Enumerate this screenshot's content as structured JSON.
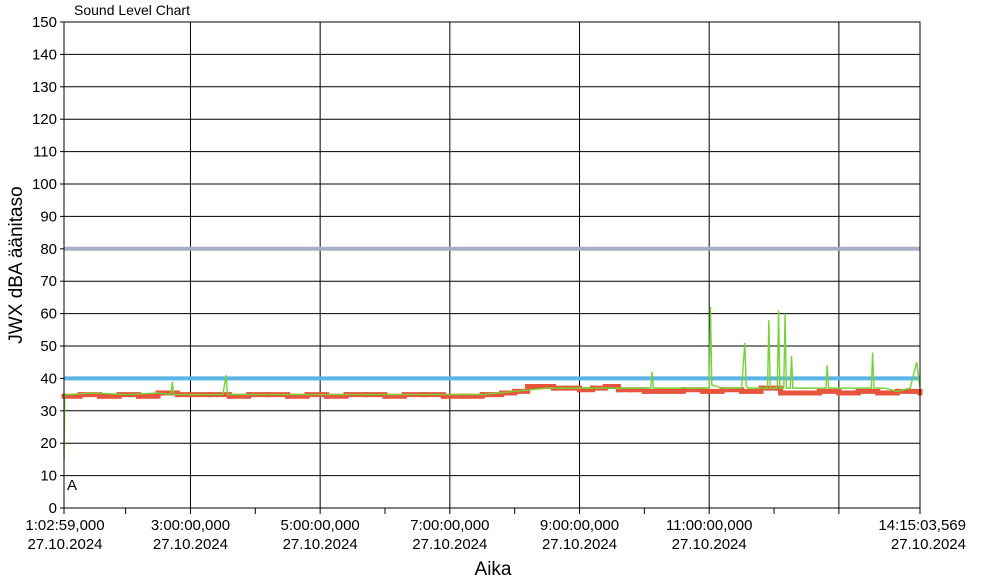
{
  "chart_data": {
    "type": "line",
    "title": "Sound Level Chart",
    "xlabel": "Aika",
    "ylabel": "JWX dBA äänitaso",
    "ylim": [
      0,
      150
    ],
    "y_ticks": [
      0,
      10,
      20,
      30,
      40,
      50,
      60,
      70,
      80,
      90,
      100,
      110,
      120,
      130,
      140,
      150
    ],
    "x_range": [
      "27.10.2024 1:02:59,000",
      "27.10.2024 14:15:03,569"
    ],
    "x_tick_labels": [
      {
        "time": "1:02:59,000",
        "date": "27.10.2024",
        "hour": 1.0497
      },
      {
        "time": "3:00:00,000",
        "date": "27.10.2024",
        "hour": 3.0
      },
      {
        "time": "5:00:00,000",
        "date": "27.10.2024",
        "hour": 5.0
      },
      {
        "time": "7:00:00,000",
        "date": "27.10.2024",
        "hour": 7.0
      },
      {
        "time": "9:00:00,000",
        "date": "27.10.2024",
        "hour": 9.0
      },
      {
        "time": "11:00:00,000",
        "date": "27.10.2024",
        "hour": 11.0
      },
      {
        "time": "14:15:03,569",
        "date": "27.10.2024",
        "hour": 14.251
      }
    ],
    "minor_tick_hours": [
      2,
      4,
      6,
      8,
      10,
      12,
      13
    ],
    "grid": true,
    "marker_label": "A",
    "reference_lines": [
      {
        "value": 80,
        "color": "#a6b0c3"
      },
      {
        "value": 40,
        "color": "#5ab4e8"
      }
    ],
    "series": [
      {
        "color": "#e8543c",
        "style": "stepped-markers",
        "x_hours": [
          1.05,
          1.3,
          1.6,
          1.9,
          2.2,
          2.5,
          2.8,
          3.0,
          3.3,
          3.6,
          3.9,
          4.2,
          4.5,
          4.8,
          5.1,
          5.4,
          5.7,
          6.0,
          6.3,
          6.6,
          6.9,
          7.2,
          7.5,
          7.8,
          8.0,
          8.2,
          8.4,
          8.6,
          8.8,
          9.0,
          9.2,
          9.4,
          9.6,
          9.8,
          10.0,
          10.3,
          10.6,
          10.9,
          11.2,
          11.5,
          11.8,
          12.1,
          12.4,
          12.7,
          13.0,
          13.3,
          13.6,
          13.9,
          14.25
        ],
        "values": [
          34.5,
          35,
          34.5,
          35,
          34.5,
          35.5,
          35,
          35,
          35,
          34.5,
          35,
          35,
          34.5,
          35,
          34.5,
          35,
          35,
          34.5,
          35,
          35,
          34.5,
          34.5,
          35,
          35.5,
          36,
          37.5,
          37.5,
          37,
          37,
          36.5,
          37,
          37.5,
          36.5,
          36.5,
          36,
          36,
          36.5,
          36,
          36.5,
          36,
          37,
          35.5,
          35.5,
          36,
          35.5,
          36,
          35.5,
          36,
          35.5
        ]
      },
      {
        "color": "#74d336",
        "style": "line",
        "x_hours": [
          1.05,
          1.06,
          1.12,
          1.5,
          2.0,
          2.5,
          2.7,
          2.72,
          2.74,
          3.0,
          3.5,
          3.55,
          3.57,
          3.59,
          4.0,
          5.0,
          6.0,
          7.0,
          7.5,
          8.0,
          8.5,
          9.0,
          9.5,
          10.0,
          10.1,
          10.12,
          10.14,
          10.5,
          10.9,
          11.0,
          11.02,
          11.04,
          11.2,
          11.5,
          11.55,
          11.57,
          11.59,
          11.8,
          11.9,
          11.92,
          11.94,
          12.0,
          12.05,
          12.07,
          12.09,
          12.15,
          12.17,
          12.19,
          12.25,
          12.27,
          12.29,
          12.4,
          12.6,
          12.8,
          12.82,
          12.84,
          13.0,
          13.2,
          13.5,
          13.52,
          13.54,
          13.7,
          13.9,
          14.1,
          14.2,
          14.25
        ],
        "values": [
          15,
          35,
          35,
          35.5,
          35,
          35.5,
          35,
          39,
          35,
          35,
          35,
          41,
          35,
          35,
          35,
          35,
          35,
          35,
          35,
          36,
          37,
          37,
          37,
          37,
          37,
          42,
          37,
          37,
          37,
          37,
          62,
          38,
          37,
          37,
          51,
          38,
          37,
          37,
          37,
          58,
          37,
          37,
          37,
          61,
          37,
          37,
          60,
          37,
          37,
          47,
          37,
          37,
          37,
          37,
          44,
          37,
          37,
          37,
          37,
          48,
          37,
          37,
          36,
          37,
          45,
          37
        ]
      }
    ]
  }
}
